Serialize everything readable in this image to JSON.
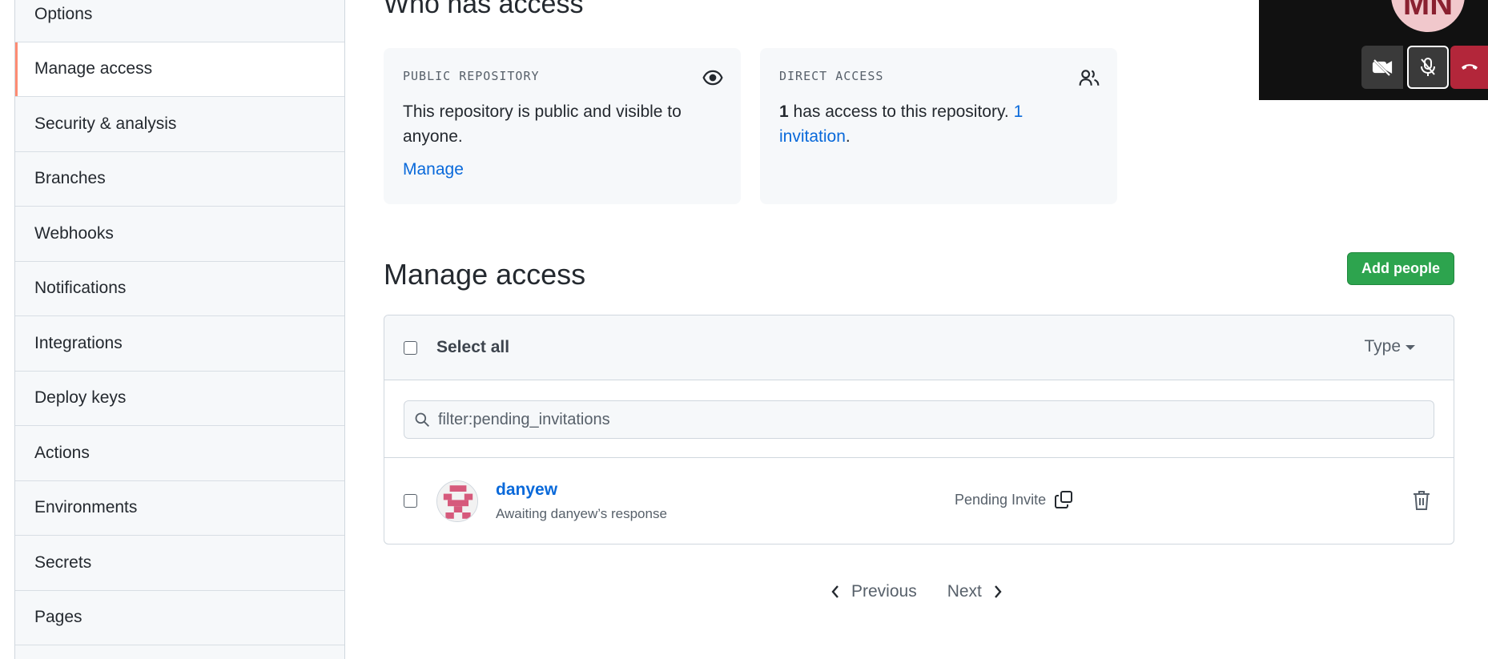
{
  "sidebar": {
    "items": [
      {
        "label": "Options"
      },
      {
        "label": "Manage access"
      },
      {
        "label": "Security & analysis"
      },
      {
        "label": "Branches"
      },
      {
        "label": "Webhooks"
      },
      {
        "label": "Notifications"
      },
      {
        "label": "Integrations"
      },
      {
        "label": "Deploy keys"
      },
      {
        "label": "Actions"
      },
      {
        "label": "Environments"
      },
      {
        "label": "Secrets"
      },
      {
        "label": "Pages"
      }
    ]
  },
  "who_has_access": {
    "title": "Who has access",
    "public_card": {
      "heading": "PUBLIC REPOSITORY",
      "body": "This repository is public and visible to anyone.",
      "link": "Manage"
    },
    "direct_card": {
      "heading": "DIRECT ACCESS",
      "count": "1",
      "body": " has access to this repository. ",
      "invitation_link": "1 invitation",
      "trailing": "."
    }
  },
  "manage_access": {
    "title": "Manage access",
    "add_button": "Add people",
    "select_all": "Select all",
    "type_dropdown": "Type",
    "filter_value": "filter:pending_invitations",
    "members": [
      {
        "name": "danyew",
        "subtitle": "Awaiting danyew’s response",
        "status": "Pending Invite"
      }
    ]
  },
  "pagination": {
    "previous": "Previous",
    "next": "Next"
  },
  "call": {
    "initials": "MN"
  },
  "colors": {
    "accent_link": "#0969da",
    "add_button": "#2da44e",
    "active_marker": "#fd8c73",
    "hangup": "#b3263a"
  }
}
